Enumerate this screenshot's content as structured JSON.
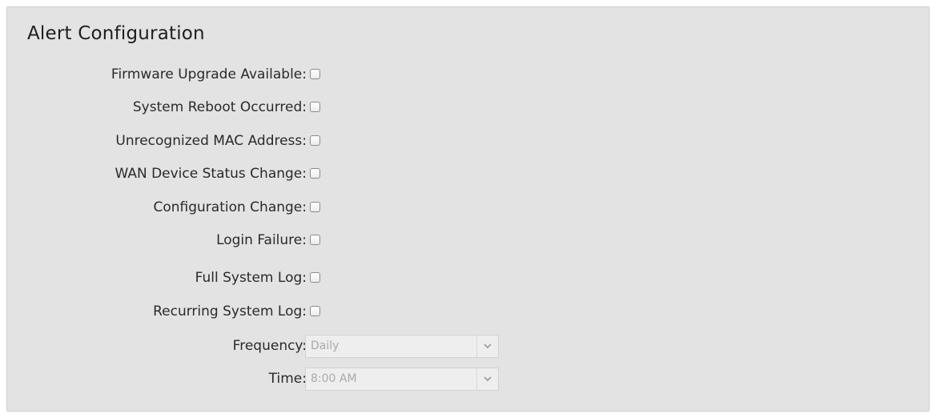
{
  "panel": {
    "title": "Alert Configuration"
  },
  "alerts": [
    {
      "label": "Firmware Upgrade Available:",
      "checked": false
    },
    {
      "label": "System Reboot Occurred:",
      "checked": false
    },
    {
      "label": "Unrecognized MAC Address:",
      "checked": false
    },
    {
      "label": "WAN Device Status Change:",
      "checked": false
    },
    {
      "label": "Configuration Change:",
      "checked": false
    },
    {
      "label": "Login Failure:",
      "checked": false
    },
    {
      "label": "Full System Log:",
      "checked": false
    },
    {
      "label": "Recurring System Log:",
      "checked": false
    }
  ],
  "frequency": {
    "label": "Frequency:",
    "value": "Daily"
  },
  "time": {
    "label": "Time:",
    "value": "8:00 AM"
  },
  "icons": {
    "dropdown": "chevron-down-icon"
  }
}
